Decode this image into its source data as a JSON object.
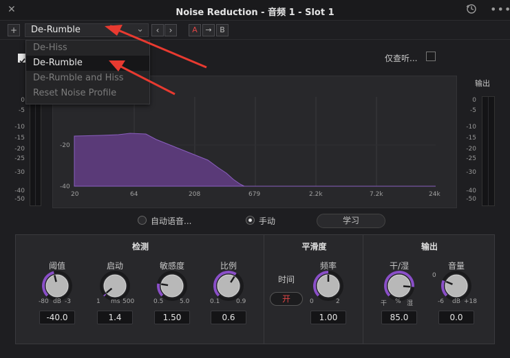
{
  "window": {
    "title": "Noise Reduction - 音频 1 -  Slot 1"
  },
  "toolbar": {
    "add_label": "+",
    "preset_value": "De-Rumble",
    "ab_a": "A",
    "ab_arrow": "→",
    "ab_b": "B"
  },
  "preset_menu": {
    "items": [
      "De-Hiss",
      "De-Rumble",
      "De-Rumble and Hiss",
      "Reset Noise Profile"
    ],
    "selected": "De-Rumble"
  },
  "listen_only_label": "仅查听...",
  "input_meter": {
    "scale": [
      "0",
      "-5",
      "-10",
      "-15",
      "-20",
      "-25",
      "-30",
      "-40",
      "-50"
    ]
  },
  "output_meter": {
    "label": "输出",
    "scale": [
      "0",
      "-5",
      "-10",
      "-15",
      "-20",
      "-25",
      "-30",
      "-40",
      "-50"
    ]
  },
  "spectrum": {
    "y_ticks": [
      "-20",
      "-40"
    ],
    "x_ticks": [
      "20",
      "64",
      "208",
      "679",
      "2.2k",
      "7.2k",
      "24k"
    ],
    "fill_color": "#5a3a78",
    "line_color": "#7a4fa0"
  },
  "mode": {
    "auto_label": "自动语音...",
    "manual_label": "手动",
    "selected": "manual",
    "learn_label": "学习"
  },
  "detect": {
    "title": "检测",
    "knobs": [
      {
        "label": "阈值",
        "min": "-80",
        "unit": "dB",
        "max": "-3",
        "value": "-40.0",
        "fraction": 0.45
      },
      {
        "label": "启动",
        "min": "1",
        "unit": "ms",
        "max": "500",
        "value": "1.4",
        "fraction": 0.02
      },
      {
        "label": "敏感度",
        "min": "0.5",
        "unit": "",
        "max": "5.0",
        "value": "1.50",
        "fraction": 0.2
      },
      {
        "label": "比例",
        "min": "0.1",
        "unit": "",
        "max": "0.9",
        "value": "0.6",
        "fraction": 0.62
      }
    ]
  },
  "smoothing": {
    "title": "平滑度",
    "time_label": "时间",
    "time_toggle": "开",
    "knob": {
      "label": "频率",
      "min": "0",
      "unit": "",
      "max": "2",
      "value": "1.00",
      "fraction": 0.5
    }
  },
  "output": {
    "title": "输出",
    "knobs": [
      {
        "label": "干/湿",
        "min": "干",
        "unit": "%",
        "max": "湿",
        "value": "85.0",
        "fraction": 0.85
      },
      {
        "label": "音量",
        "min": "-6",
        "unit": "dB",
        "max": "+18",
        "value": "0.0",
        "fraction": 0.25,
        "top_mark": "0"
      }
    ]
  },
  "colors": {
    "accent": "#8a4fc8",
    "toggle_on": "#e04545",
    "annotation_arrow": "#e83a30"
  }
}
